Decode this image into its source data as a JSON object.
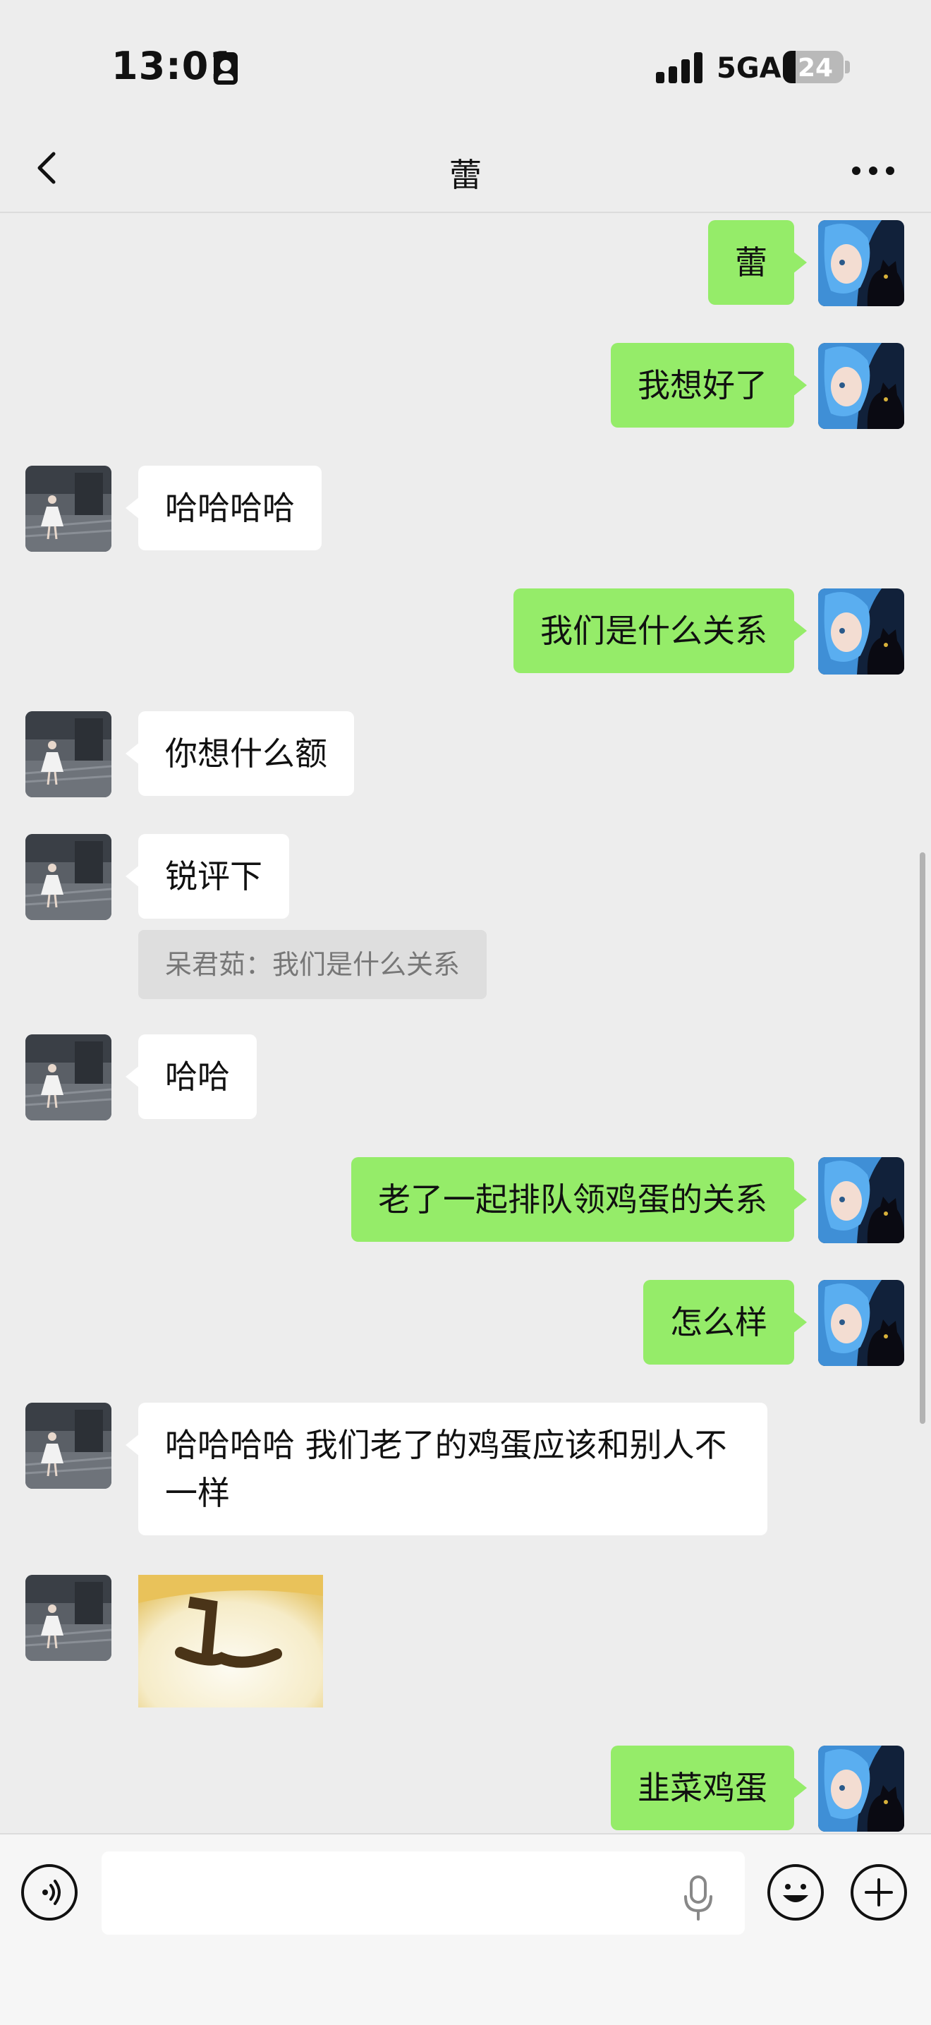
{
  "status_bar": {
    "time": "13:01",
    "network": "5GA",
    "battery": "24"
  },
  "header": {
    "title": "蕾"
  },
  "messages": [
    {
      "sender": "me",
      "text": "蕾"
    },
    {
      "sender": "me",
      "text": "我想好了"
    },
    {
      "sender": "them",
      "text": "哈哈哈哈"
    },
    {
      "sender": "me",
      "text": "我们是什么关系"
    },
    {
      "sender": "them",
      "text": "你想什么额"
    },
    {
      "sender": "them",
      "text": "锐评下",
      "quote": "呆君茹：我们是什么关系"
    },
    {
      "sender": "them",
      "text": "哈哈"
    },
    {
      "sender": "me",
      "text": "老了一起排队领鸡蛋的关系"
    },
    {
      "sender": "me",
      "text": "怎么样"
    },
    {
      "sender": "them",
      "text": "哈哈哈哈 我们老了的鸡蛋应该和别人不一样"
    },
    {
      "sender": "them",
      "type": "sticker"
    },
    {
      "sender": "me",
      "text": "韭菜鸡蛋"
    }
  ],
  "input_bar": {
    "value": "",
    "placeholder": ""
  },
  "icons": {
    "back": "chevron-left-icon",
    "more": "more-icon",
    "voice": "voice-icon",
    "mic": "microphone-icon",
    "emoji": "emoji-icon",
    "plus": "plus-icon"
  },
  "colors": {
    "my_bubble": "#95ec69",
    "their_bubble": "#ffffff",
    "background": "#ededed"
  }
}
